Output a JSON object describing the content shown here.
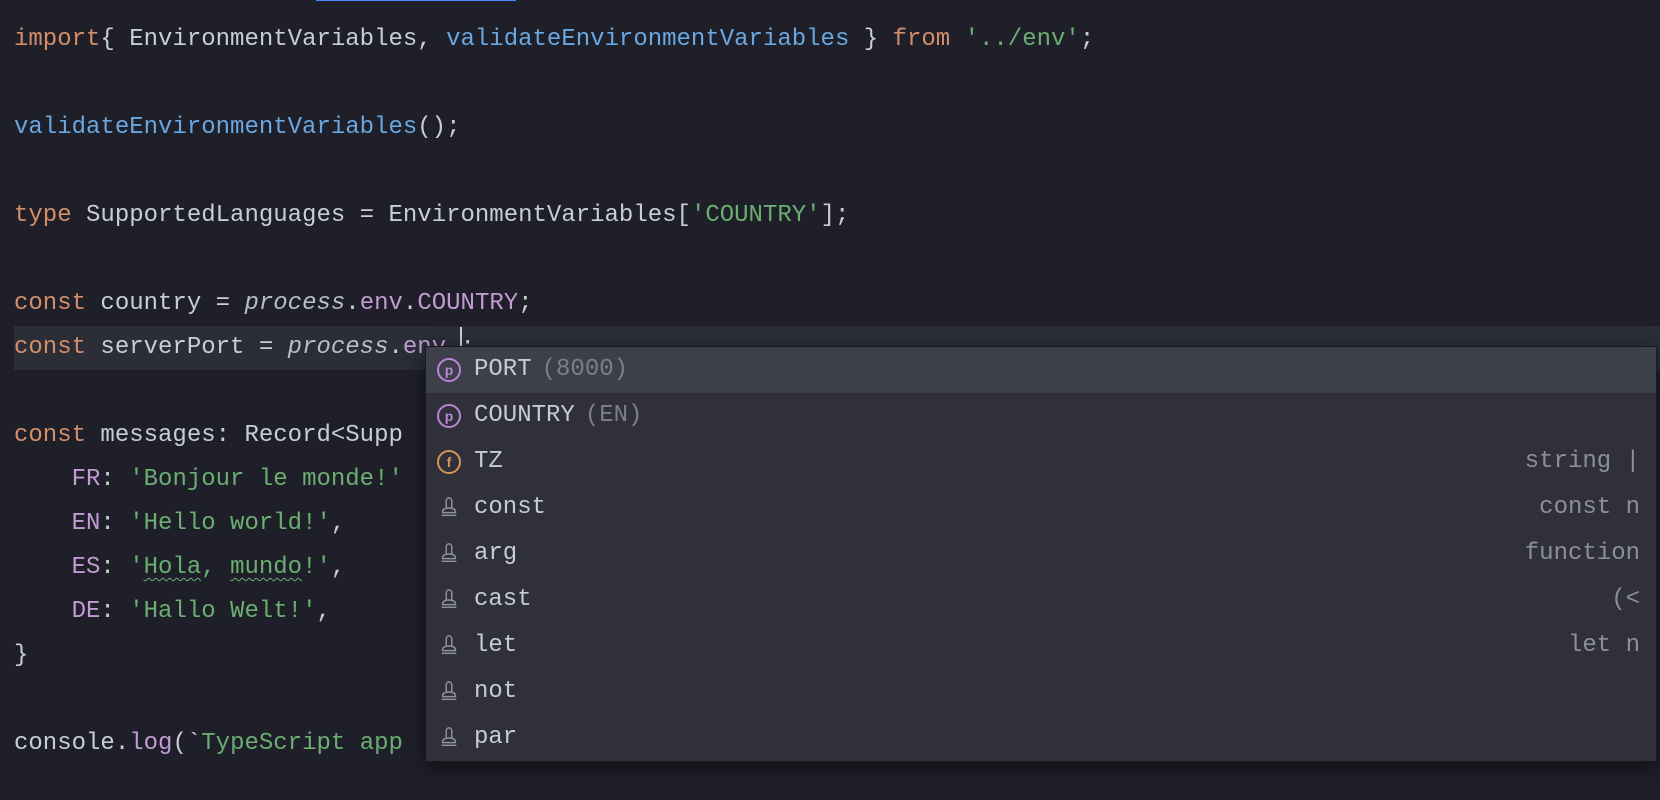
{
  "code": {
    "l1": {
      "kw_import": "import",
      "brace_l": "{ ",
      "id1": "EnvironmentVariables",
      "comma": ", ",
      "id2": "validateEnvironmentVariables",
      "brace_r": " }",
      "kw_from": " from ",
      "str": "'../env'",
      "semi": ";"
    },
    "l3": {
      "fn": "validateEnvironmentVariables",
      "parens": "();"
    },
    "l5": {
      "kw_type": "type ",
      "name": "SupportedLanguages",
      "eq": " = ",
      "base": "EnvironmentVariables",
      "open": "[",
      "key": "'COUNTRY'",
      "close": "];"
    },
    "l7": {
      "kw_const": "const ",
      "name": "country",
      "eq": " = ",
      "proc": "process",
      "dot1": ".",
      "env": "env",
      "dot2": ".",
      "prop": "COUNTRY",
      "semi": ";"
    },
    "l8": {
      "kw_const": "const ",
      "name": "serverPort",
      "eq": " = ",
      "proc": "process",
      "dot1": ".",
      "env": "env",
      "dot2": ".",
      "semi": ";"
    },
    "l10": {
      "kw_const": "const ",
      "name": "messages",
      "colon": ": ",
      "rec": "Record",
      "open": "<",
      "arg1": "Supp"
    },
    "l11": {
      "indent": "    ",
      "key": "FR",
      "colon": ": ",
      "str": "'Bonjour le monde!'"
    },
    "l12": {
      "indent": "    ",
      "key": "EN",
      "colon": ": ",
      "str": "'Hello world!'",
      "comma": ","
    },
    "l13": {
      "indent": "    ",
      "key": "ES",
      "colon": ": ",
      "q1": "'",
      "w1": "Hola",
      "c": ", ",
      "w2": "mundo",
      "q2": "!'",
      "comma": ","
    },
    "l14": {
      "indent": "    ",
      "key": "DE",
      "colon": ": ",
      "str": "'Hallo Welt!'",
      "comma": ","
    },
    "l15": {
      "brace": "}"
    },
    "l17": {
      "obj": "console",
      "dot": ".",
      "fn": "log",
      "tick": "(`",
      "txt": "TypeScript app"
    }
  },
  "popup": {
    "items": [
      {
        "icon": "p-purple",
        "name": "PORT",
        "detail": "(8000)",
        "right": "",
        "selected": true
      },
      {
        "icon": "p-purple",
        "name": "COUNTRY",
        "detail": "(EN)",
        "right": "",
        "selected": false
      },
      {
        "icon": "f-orange",
        "name": "TZ",
        "detail": "",
        "right": "string |",
        "selected": false
      },
      {
        "icon": "stamp",
        "name": "const",
        "detail": "",
        "right": "const n",
        "selected": false
      },
      {
        "icon": "stamp",
        "name": "arg",
        "detail": "",
        "right": "function",
        "selected": false
      },
      {
        "icon": "stamp",
        "name": "cast",
        "detail": "",
        "right": "(<",
        "selected": false
      },
      {
        "icon": "stamp",
        "name": "let",
        "detail": "",
        "right": "let n",
        "selected": false
      },
      {
        "icon": "stamp",
        "name": "not",
        "detail": "",
        "right": "",
        "selected": false
      },
      {
        "icon": "stamp",
        "name": "par",
        "detail": "",
        "right": "",
        "selected": false
      }
    ]
  }
}
